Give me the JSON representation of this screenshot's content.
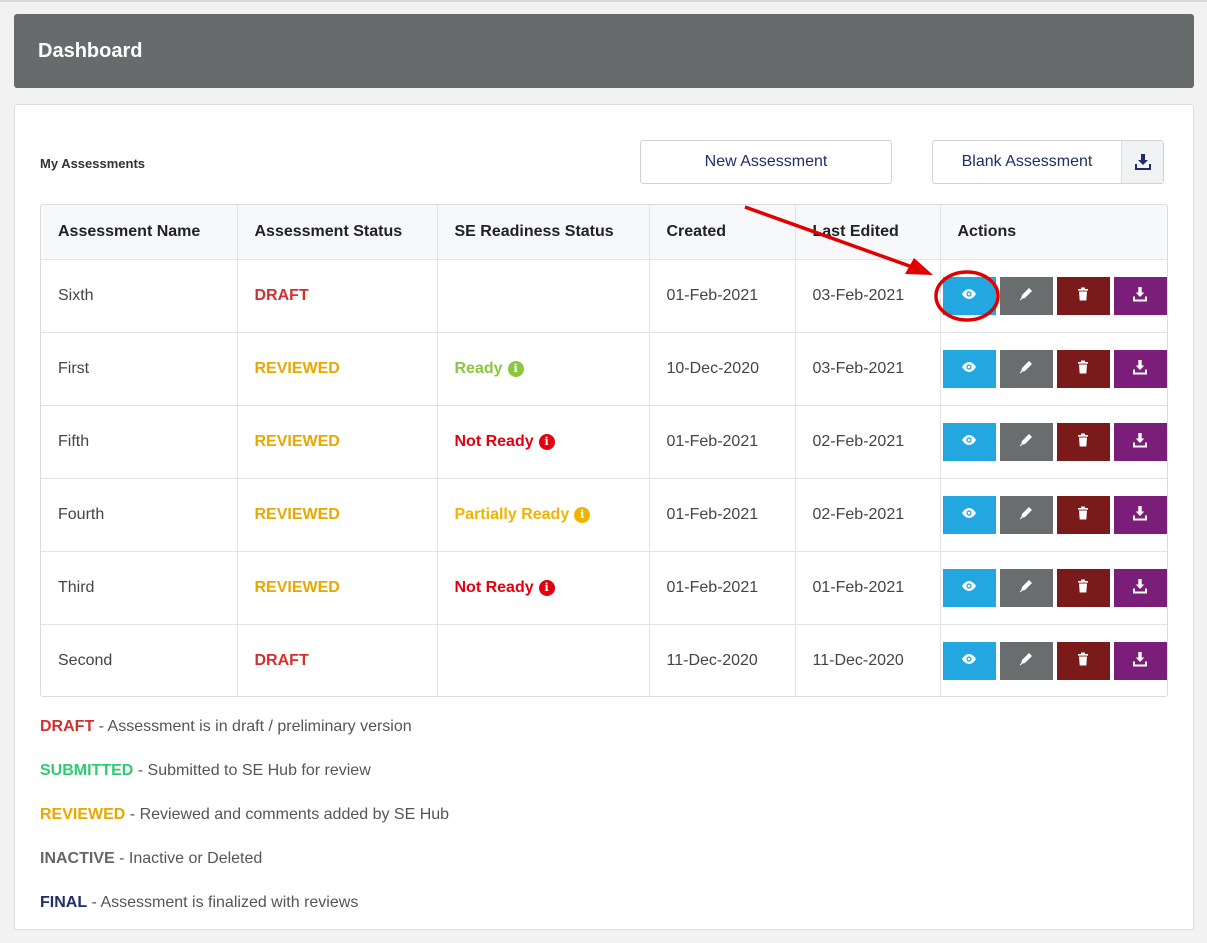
{
  "header": {
    "title": "Dashboard"
  },
  "section": {
    "title": "My Assessments"
  },
  "buttons": {
    "new_assessment": "New Assessment",
    "blank_assessment": "Blank Assessment",
    "blank_download_icon": "download-icon"
  },
  "table": {
    "columns": [
      "Assessment Name",
      "Assessment Status",
      "SE Readiness Status",
      "Created",
      "Last Edited",
      "Actions"
    ],
    "rows": [
      {
        "name": "Sixth",
        "status": "DRAFT",
        "status_color": "#d32f2f",
        "readiness": "",
        "readiness_color": "",
        "created": "01-Feb-2021",
        "edited": "03-Feb-2021"
      },
      {
        "name": "First",
        "status": "REVIEWED",
        "status_color": "#e8a800",
        "readiness": "Ready",
        "readiness_color": "#8cc63f",
        "created": "10-Dec-2020",
        "edited": "03-Feb-2021"
      },
      {
        "name": "Fifth",
        "status": "REVIEWED",
        "status_color": "#e8a800",
        "readiness": "Not Ready",
        "readiness_color": "#e3000f",
        "created": "01-Feb-2021",
        "edited": "02-Feb-2021"
      },
      {
        "name": "Fourth",
        "status": "REVIEWED",
        "status_color": "#e8a800",
        "readiness": "Partially Ready",
        "readiness_color": "#f0b400",
        "created": "01-Feb-2021",
        "edited": "02-Feb-2021"
      },
      {
        "name": "Third",
        "status": "REVIEWED",
        "status_color": "#e8a800",
        "readiness": "Not Ready",
        "readiness_color": "#e3000f",
        "created": "01-Feb-2021",
        "edited": "01-Feb-2021"
      },
      {
        "name": "Second",
        "status": "DRAFT",
        "status_color": "#d32f2f",
        "readiness": "",
        "readiness_color": "",
        "created": "11-Dec-2020",
        "edited": "11-Dec-2020"
      }
    ],
    "action_icons": [
      "eye-icon",
      "pencil-icon",
      "trash-icon",
      "download-icon"
    ],
    "action_colors": [
      "#22a7e0",
      "#6a6d6e",
      "#7a1a1a",
      "#7b1e79"
    ]
  },
  "legend": [
    {
      "term": "DRAFT",
      "color": "#d32f2f",
      "desc": " - Assessment is in draft / preliminary version"
    },
    {
      "term": "SUBMITTED",
      "color": "#2ecc71",
      "desc": " - Submitted to SE Hub for review"
    },
    {
      "term": "REVIEWED",
      "color": "#e8a800",
      "desc": " - Reviewed and comments added by SE Hub"
    },
    {
      "term": "INACTIVE",
      "color": "#666666",
      "desc": " - Inactive or Deleted"
    },
    {
      "term": "FINAL",
      "color": "#1f2d6b",
      "desc": " - Assessment is finalized with reviews"
    }
  ],
  "annotation_color": "#e00000"
}
